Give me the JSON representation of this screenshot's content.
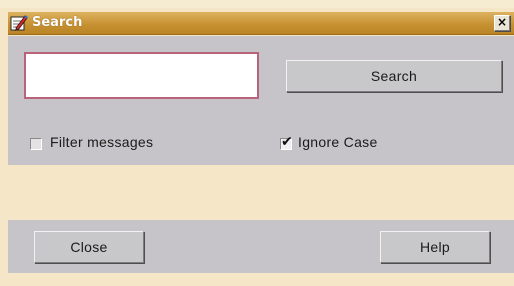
{
  "window": {
    "title": "Search",
    "close_glyph": "×",
    "icon": "edit-pencil-icon"
  },
  "search": {
    "value": "",
    "placeholder": "",
    "button_label": "Search"
  },
  "options": {
    "filter_messages": {
      "label": "Filter messages",
      "checked": false
    },
    "ignore_case": {
      "label": "Ignore Case",
      "checked": true,
      "check_glyph": "✔"
    }
  },
  "footer": {
    "close_label": "Close",
    "help_label": "Help"
  },
  "colors": {
    "background": "#f4e6c6",
    "titlebar": "#c89233",
    "panel": "#c6c4c8",
    "input_border": "#b8637a"
  }
}
